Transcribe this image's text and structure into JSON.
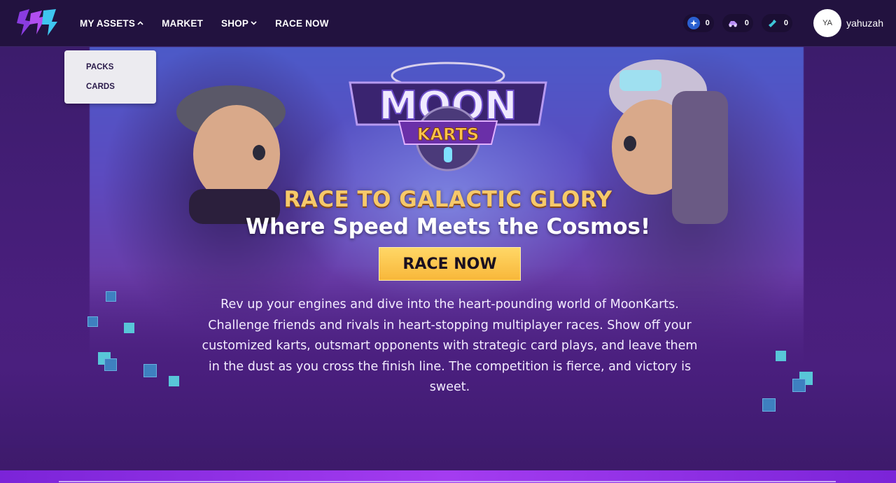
{
  "header": {
    "nav": [
      {
        "label": "MY ASSETS",
        "chevron": "^"
      },
      {
        "label": "MARKET"
      },
      {
        "label": "SHOP",
        "chevron": "v"
      },
      {
        "label": "RACE NOW"
      }
    ],
    "wallet": [
      {
        "icon": "star-token-icon",
        "value": "0"
      },
      {
        "icon": "kart-icon",
        "value": "0"
      },
      {
        "icon": "ticket-icon",
        "value": "0"
      }
    ],
    "user": {
      "initials": "YA",
      "name": "yahuzah"
    }
  },
  "dropdown": {
    "items": [
      "PACKS",
      "CARDS"
    ]
  },
  "hero": {
    "logo_top": "MOON",
    "logo_bottom": "KARTS",
    "headline": "RACE TO GALACTIC GLORY",
    "subheadline": "Where Speed Meets the Cosmos!",
    "cta": "RACE NOW",
    "description": "Rev up your engines and dive into the heart-pounding world of MoonKarts. Challenge friends and rivals in heart-stopping multiplayer races. Show off your customized karts, outsmart opponents with strategic card plays, and leave them in the dust as you cross the finish line. The competition is fierce, and victory is sweet."
  },
  "colors": {
    "header_bg": "#22123f",
    "page_bg": "#4a1f7e",
    "cta_yellow": "#f8b73a",
    "headline_gold": "#f6c96a"
  }
}
